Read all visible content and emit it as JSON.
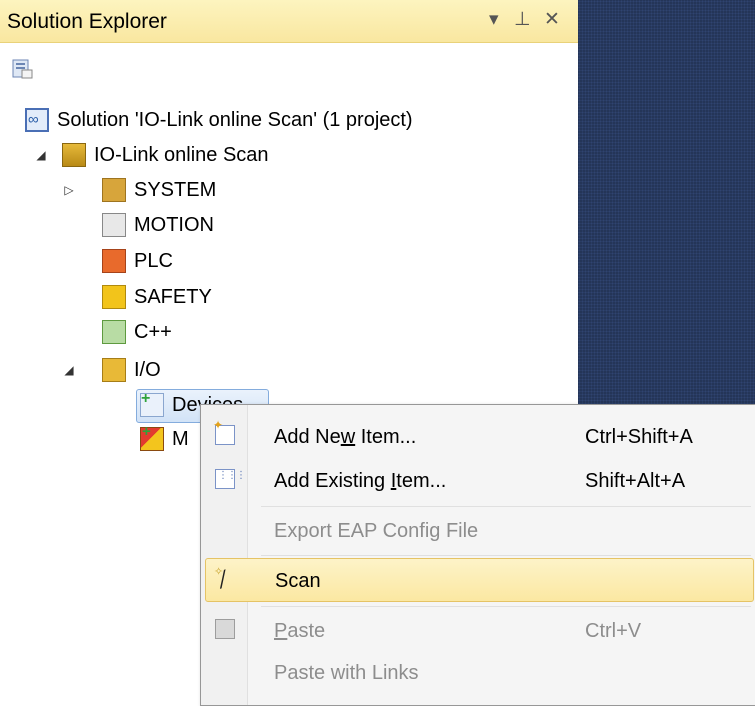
{
  "window": {
    "title": "Solution Explorer",
    "dropdown_glyph": "▾",
    "pin_glyph": "⊥",
    "close_glyph": "✕"
  },
  "tree": {
    "solution": "Solution 'IO-Link online Scan' (1 project)",
    "project": "IO-Link online Scan",
    "items": {
      "system": "SYSTEM",
      "motion": "MOTION",
      "plc": "PLC",
      "safety": "SAFETY",
      "cpp": "C++",
      "io": "I/O",
      "devices": "Devices",
      "mappings": "M"
    },
    "expander_collapsed": "▷",
    "expander_expanded": "◢"
  },
  "context_menu": {
    "add_new_item": {
      "pre": "Add Ne",
      "ul": "w",
      "post": " Item...",
      "shortcut": "Ctrl+Shift+A"
    },
    "add_existing_item": {
      "pre": "Add Existing ",
      "ul": "I",
      "post": "tem...",
      "shortcut": "Shift+Alt+A"
    },
    "export_eap": {
      "label": "Export EAP Config File"
    },
    "scan": {
      "label": "Scan"
    },
    "paste": {
      "ul": "P",
      "post": "aste",
      "shortcut": "Ctrl+V"
    },
    "paste_links": {
      "label": "Paste with Links"
    }
  }
}
